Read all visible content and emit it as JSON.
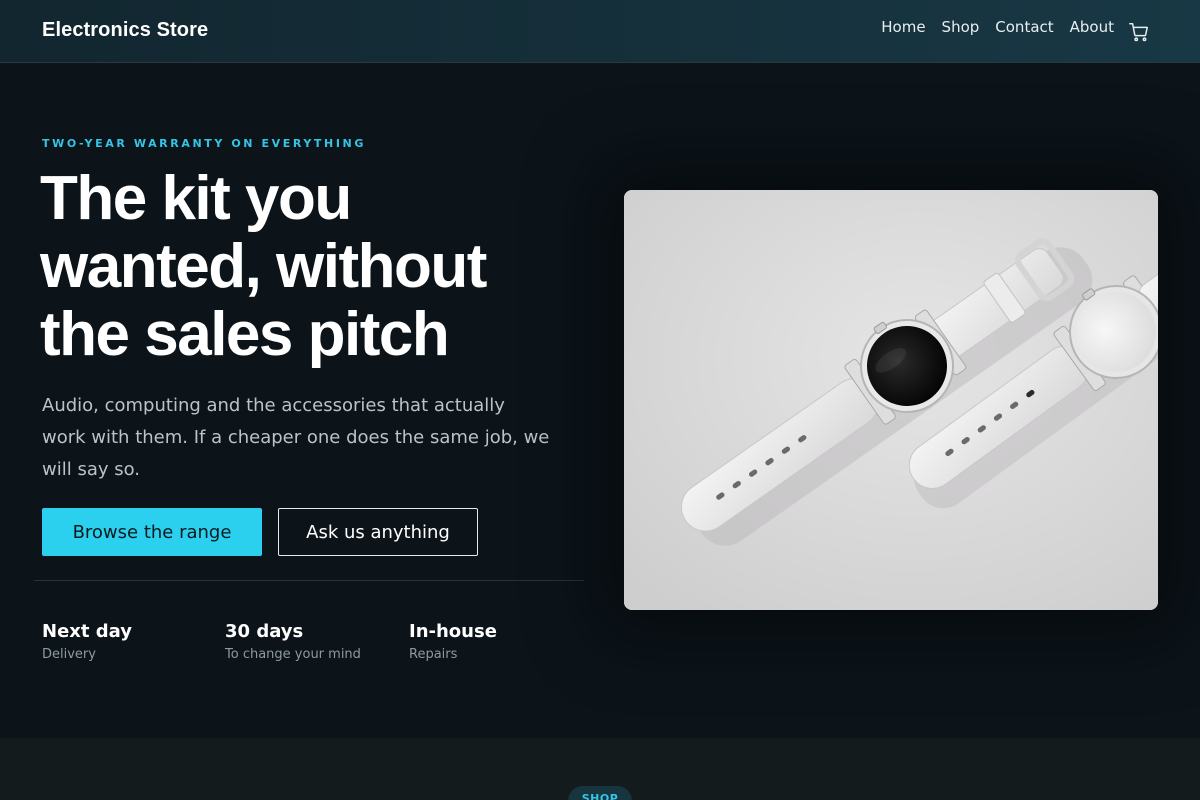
{
  "header": {
    "brand": "Electronics Store",
    "nav": [
      "Home",
      "Shop",
      "Contact",
      "About"
    ],
    "cart_icon": "shopping-cart-icon"
  },
  "hero": {
    "eyebrow": "TWO-YEAR WARRANTY ON EVERYTHING",
    "headline": "The kit you wanted, without the sales pitch",
    "subcopy": "Audio, computing and the accessories that actually work with them. If a cheaper one does the same job, we will say so.",
    "primary_cta": "Browse the range",
    "secondary_cta": "Ask us anything",
    "stats": [
      {
        "title": "Next day",
        "sub": "Delivery"
      },
      {
        "title": "30 days",
        "sub": "To change your mind"
      },
      {
        "title": "In-house",
        "sub": "Repairs"
      }
    ]
  },
  "next_section": {
    "pill": "SHOP"
  },
  "colors": {
    "accent": "#2ad0ee",
    "eyebrow": "#35c4e6",
    "background": "#0c141a",
    "header": "#183845"
  }
}
